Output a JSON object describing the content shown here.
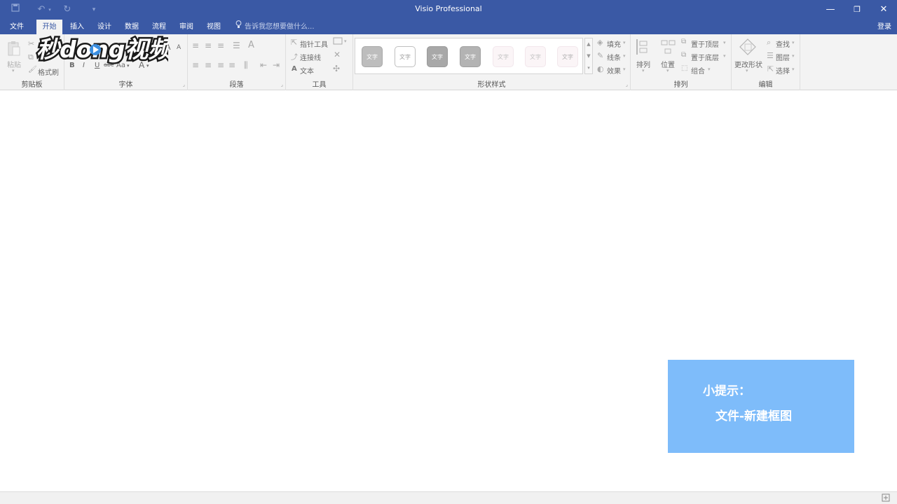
{
  "window": {
    "title": "Visio Professional",
    "qat": {
      "save_icon": "save-icon",
      "undo_icon": "undo-icon",
      "redo_icon": "redo-icon",
      "customize_icon": "customize-icon"
    },
    "minimize": "—",
    "restore": "❐",
    "close": "✕"
  },
  "tabs": [
    {
      "label": "文件"
    },
    {
      "label": "开始"
    },
    {
      "label": "插入"
    },
    {
      "label": "设计"
    },
    {
      "label": "数据"
    },
    {
      "label": "流程"
    },
    {
      "label": "审阅"
    },
    {
      "label": "视图"
    }
  ],
  "tellme": {
    "text": "告诉我您想要做什么..."
  },
  "account": {
    "login": "登录"
  },
  "ribbon": {
    "clipboard": {
      "label": "剪贴板",
      "paste": "粘贴",
      "format_painter": "格式刷"
    },
    "font": {
      "label": "字体",
      "bold": "B",
      "italic": "I",
      "underline": "U",
      "strike": "abc",
      "case": "Aa",
      "color": "A",
      "grow": "A",
      "shrink": "A"
    },
    "paragraph": {
      "label": "段落"
    },
    "tools": {
      "label": "工具",
      "pointer": "指针工具",
      "connector": "连接线",
      "text": "文本",
      "text_prefix": "A"
    },
    "shape_styles": {
      "label": "形状样式",
      "swatches": [
        {
          "text": "文字",
          "bg": "#bdbdbd",
          "fg": "#ffffff",
          "border": "#a8a8a8"
        },
        {
          "text": "文字",
          "bg": "#ffffff",
          "fg": "#a0a0a0",
          "border": "#bfbfbf"
        },
        {
          "text": "文字",
          "bg": "#a8a8a8",
          "fg": "#ffffff",
          "border": "#9a9a9a"
        },
        {
          "text": "文字",
          "bg": "#b3b3b3",
          "fg": "#ffffff",
          "border": "#a0a0a0"
        },
        {
          "text": "文字",
          "bg": "#fbf5f7",
          "fg": "#c3c3c3",
          "border": "#f2e7ec"
        },
        {
          "text": "文字",
          "bg": "#fbf5f7",
          "fg": "#c3c3c3",
          "border": "#f2e7ec"
        },
        {
          "text": "文字",
          "bg": "#fbf5f7",
          "fg": "#b0b0b0",
          "border": "#f2e7ec"
        }
      ],
      "fill": "填充",
      "line": "线条",
      "effects": "效果"
    },
    "arrange": {
      "label": "排列",
      "arrange_btn": "排列",
      "position": "位置",
      "bring_front": "置于顶层",
      "send_back": "置于底层",
      "group": "组合"
    },
    "editing": {
      "label": "编辑",
      "change_shape": "更改形状",
      "find": "查找",
      "layers": "图层",
      "select": "选择"
    }
  },
  "watermark": {
    "text": "秒dong视频"
  },
  "hint": {
    "title": "小提示：",
    "body": "文件-新建框图"
  }
}
